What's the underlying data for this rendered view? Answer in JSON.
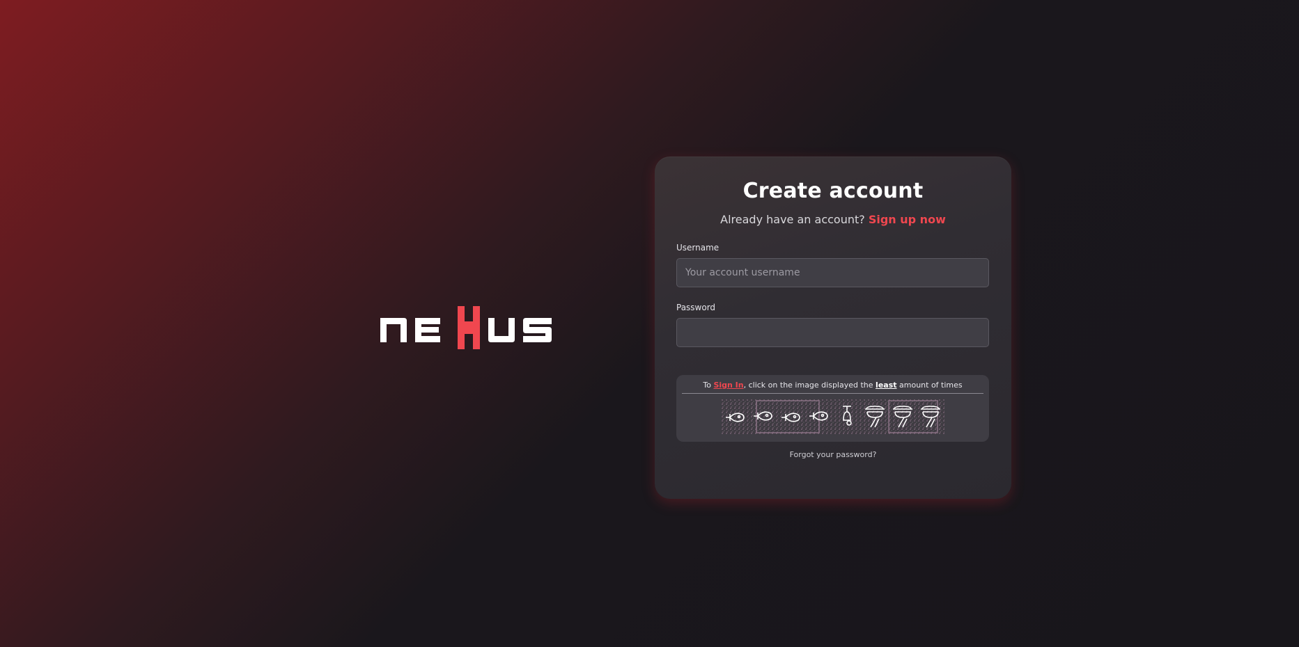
{
  "brand": {
    "name": "nexus",
    "accent": "#f0474f"
  },
  "form": {
    "title": "Create account",
    "subtitle_prefix": "Already have an account?",
    "subtitle_link": "Sign up now",
    "username_label": "Username",
    "username_placeholder": "Your account username",
    "username_value": "",
    "password_label": "Password",
    "password_value": ""
  },
  "captcha": {
    "text_prefix": "To",
    "text_link": "Sign In",
    "text_middle": ", click on the image displayed the",
    "text_emphasis": "least",
    "text_suffix": "amount of times",
    "icons": [
      "fish-icon",
      "fish-icon",
      "fish-icon",
      "fish-icon",
      "lamp-icon",
      "hat-icon",
      "hat-icon",
      "hat-icon"
    ]
  },
  "footer": {
    "forgot_label": "Forgot your password?"
  }
}
